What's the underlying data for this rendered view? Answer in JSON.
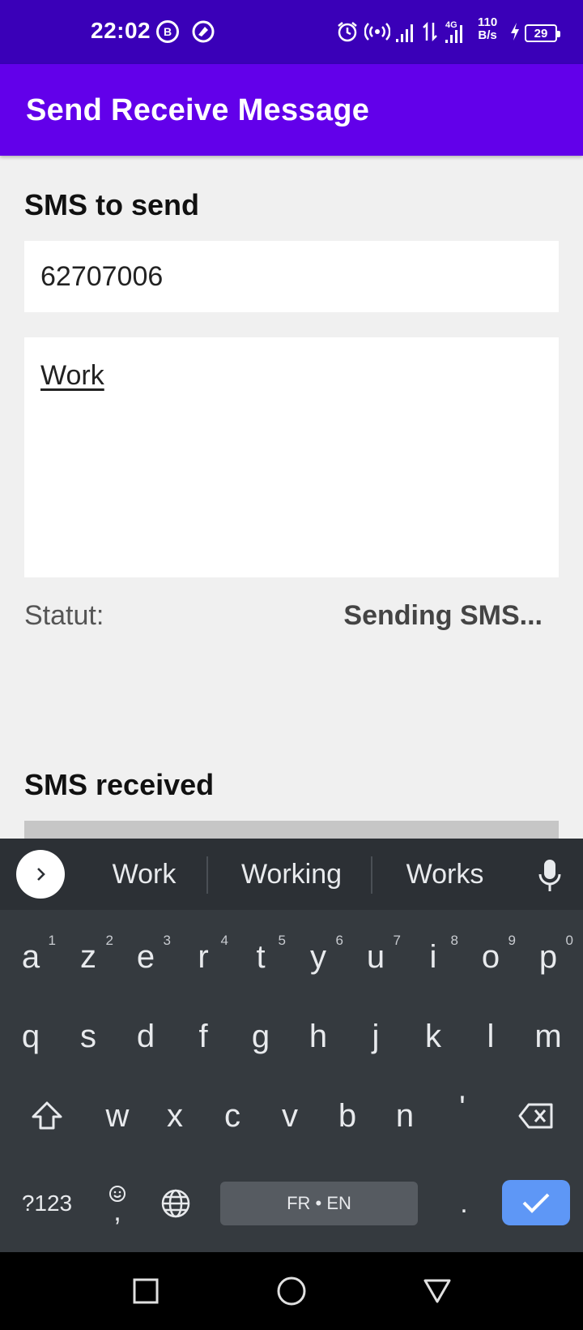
{
  "status_bar": {
    "time": "22:02",
    "badge_b": "B",
    "net_speed_value": "110",
    "net_speed_unit": "B/s",
    "battery_level": "29",
    "net_type": "4G",
    "icons": [
      "b-badge-icon",
      "vpn-icon",
      "alarm-icon",
      "hotspot-icon",
      "signal-icon",
      "data-arrows-icon",
      "signal-4g-icon",
      "charging-icon",
      "battery-icon"
    ]
  },
  "app_bar": {
    "title": "Send Receive Message"
  },
  "send_section": {
    "title": "SMS to send",
    "phone_value": "62707006",
    "message_value": "Work",
    "status_label": "Statut:",
    "status_value": "Sending SMS..."
  },
  "received_section": {
    "title": "SMS received"
  },
  "keyboard": {
    "suggestions": [
      "Work",
      "Working",
      "Works"
    ],
    "row1": [
      {
        "k": "a",
        "n": "1"
      },
      {
        "k": "z",
        "n": "2"
      },
      {
        "k": "e",
        "n": "3"
      },
      {
        "k": "r",
        "n": "4"
      },
      {
        "k": "t",
        "n": "5"
      },
      {
        "k": "y",
        "n": "6"
      },
      {
        "k": "u",
        "n": "7"
      },
      {
        "k": "i",
        "n": "8"
      },
      {
        "k": "o",
        "n": "9"
      },
      {
        "k": "p",
        "n": "0"
      }
    ],
    "row2": [
      "q",
      "s",
      "d",
      "f",
      "g",
      "h",
      "j",
      "k",
      "l",
      "m"
    ],
    "row3": [
      "w",
      "x",
      "c",
      "v",
      "b",
      "n",
      "'"
    ],
    "symbols_label": "?123",
    "comma_label": ",",
    "period_label": ".",
    "space_label": "FR • EN"
  },
  "nav_bar": {
    "buttons": [
      "recents-square-icon",
      "home-circle-icon",
      "back-triangle-icon"
    ]
  },
  "colors": {
    "status_bar": "#3a00b8",
    "app_bar": "#6200ea",
    "background": "#f0f0f0",
    "keyboard": "#353a3f",
    "enter_key": "#5e97f6"
  }
}
